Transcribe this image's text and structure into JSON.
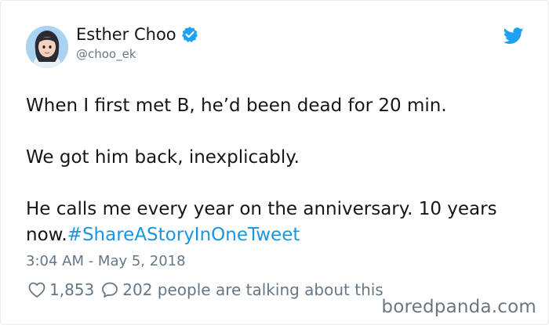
{
  "user": {
    "name": "Esther Choo",
    "handle": "@choo_ek",
    "verified": true
  },
  "tweet": {
    "paragraphs": [
      "When I first met B, he’d been dead for 20 min.",
      "We got him back, inexplicably.",
      "He calls me every year on the anniversary. 10 years now."
    ],
    "hashtag": "#ShareAStoryInOneTweet",
    "timestamp": "3:04 AM - May 5, 2018"
  },
  "engagement": {
    "likes": "1,853",
    "replies_text": "202 people are talking about this"
  },
  "watermark": "boredpanda.com",
  "icons": {
    "verified": "verified-badge-icon",
    "bird": "twitter-bird-icon",
    "like": "heart-icon",
    "reply": "reply-bubble-icon"
  },
  "colors": {
    "accent": "#1da1f2",
    "hashtag": "#1b95e0",
    "muted": "#657786",
    "text": "#14171a"
  }
}
